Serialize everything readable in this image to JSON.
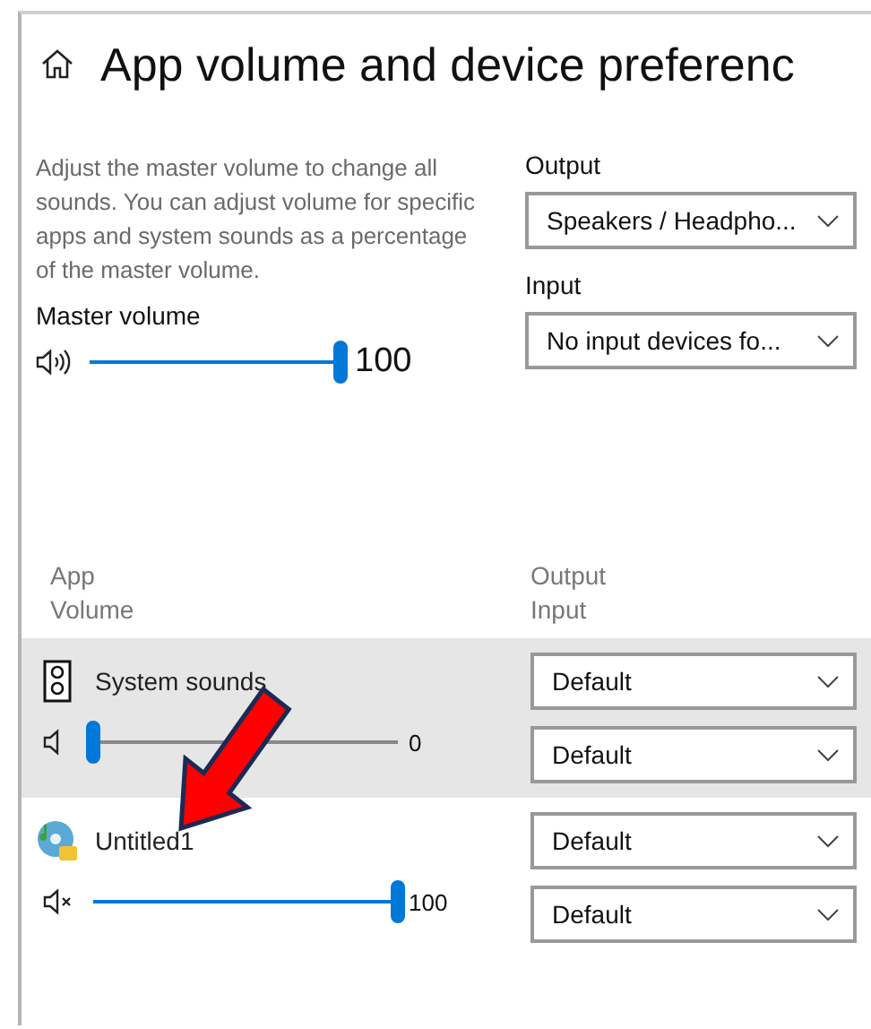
{
  "page": {
    "title": "App volume and device preferenc"
  },
  "master": {
    "description": "Adjust the master volume to change all sounds. You can adjust volume for specific apps and system sounds as a percentage of the master volume.",
    "label": "Master volume",
    "muted": false,
    "level": 1,
    "reading": "100"
  },
  "output": {
    "label": "Output",
    "value": "Speakers / Headpho..."
  },
  "input": {
    "label": "Input",
    "value": "No input devices fo..."
  },
  "app_column": {
    "title": "App",
    "subtitle": "Volume"
  },
  "device_column": {
    "title": "Output",
    "subtitle": "Input"
  },
  "apps": [
    {
      "name": "System sounds",
      "kind": "system",
      "selected": true,
      "muted": false,
      "level": 0,
      "reading": "0",
      "output": "Default",
      "input": "Default"
    },
    {
      "name": "Untitled1",
      "kind": "app",
      "selected": false,
      "muted": true,
      "level": 1,
      "reading": "100",
      "output": "Default",
      "input": "Default"
    }
  ]
}
